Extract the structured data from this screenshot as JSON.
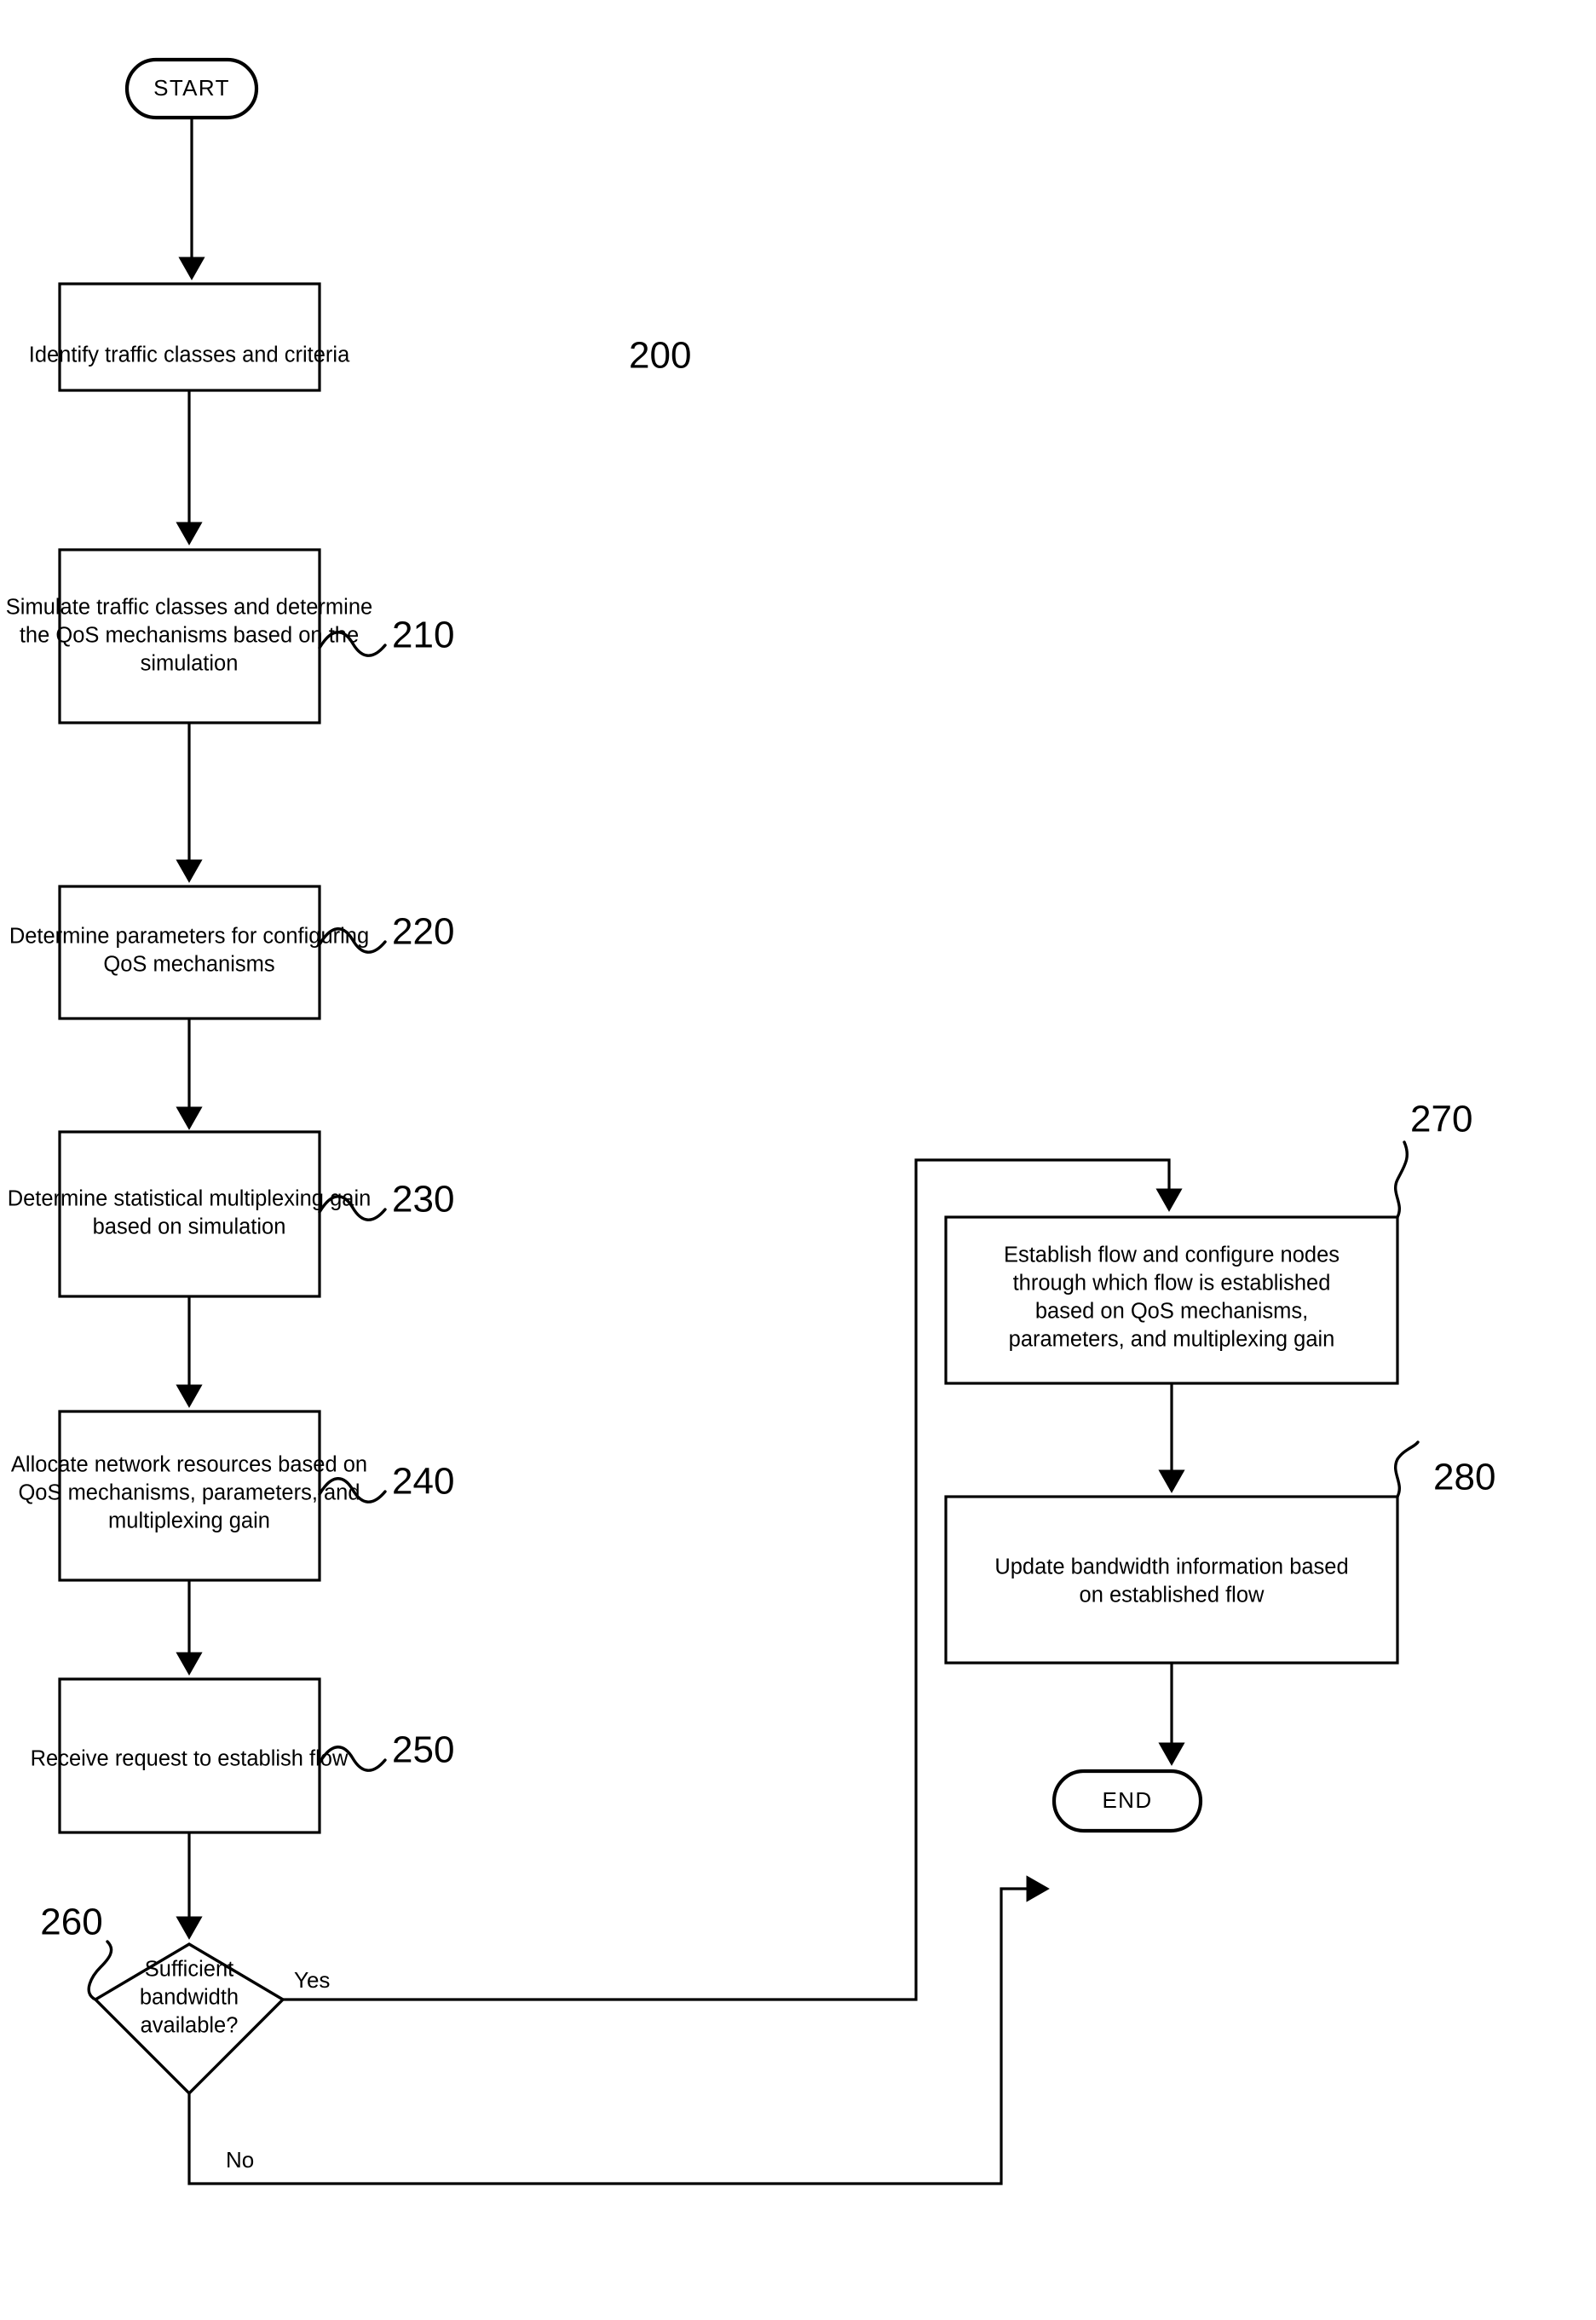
{
  "figure": {
    "type": "flowchart",
    "title": "",
    "orientation": "two-column vertical flow"
  },
  "terminators": {
    "start": {
      "label": "START",
      "ref": ""
    },
    "end": {
      "label": "END",
      "ref": ""
    }
  },
  "steps": [
    {
      "ref": "200",
      "lines": [
        "Identify traffic classes and criteria"
      ],
      "leader": "straight"
    },
    {
      "ref": "210",
      "lines": [
        "Simulate traffic classes and determine",
        "the QoS mechanisms based on the",
        "simulation"
      ],
      "leader": "squiggle"
    },
    {
      "ref": "220",
      "lines": [
        "Determine parameters for configuring",
        "QoS mechanisms"
      ],
      "leader": "squiggle"
    },
    {
      "ref": "230",
      "lines": [
        "Determine statistical multiplexing gain",
        "based on simulation"
      ],
      "leader": "squiggle"
    },
    {
      "ref": "240",
      "lines": [
        "Allocate network resources based on",
        "QoS mechanisms, parameters, and",
        "multiplexing gain"
      ],
      "leader": "squiggle"
    },
    {
      "ref": "250",
      "lines": [
        "Receive request to establish flow"
      ],
      "leader": "squiggle"
    },
    {
      "ref": "270",
      "lines": [
        "Establish flow and configure nodes",
        "through which flow is established",
        "based on QoS mechanisms,",
        "parameters, and multiplexing gain"
      ],
      "leader": "squiggle-top"
    },
    {
      "ref": "280",
      "lines": [
        "Update bandwidth information based",
        "on established flow"
      ],
      "leader": "squiggle-top"
    }
  ],
  "decision": {
    "ref": "260",
    "lines": [
      "Sufficient",
      "bandwidth",
      "available?"
    ],
    "branches": [
      {
        "label": "Yes",
        "direction": "right"
      },
      {
        "label": "No",
        "direction": "down"
      }
    ]
  },
  "colors": {
    "stroke": "#000000",
    "fill": "#ffffff",
    "text": "#000000"
  }
}
